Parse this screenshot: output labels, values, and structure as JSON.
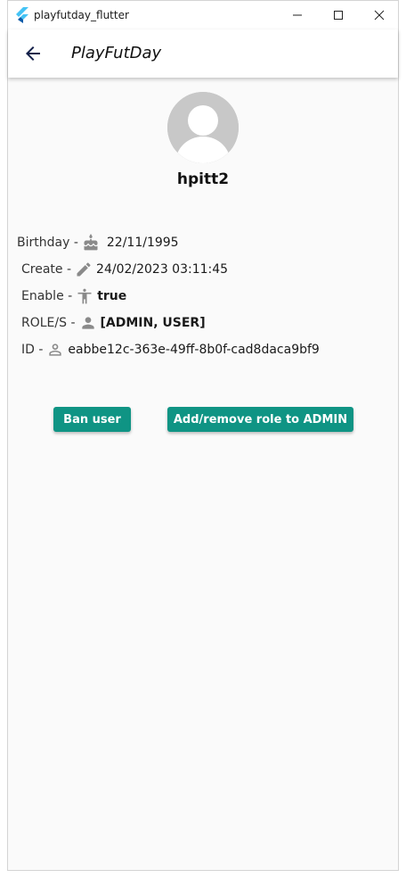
{
  "window": {
    "title": "playfutday_flutter",
    "minimize_icon": "minimize-icon",
    "maximize_icon": "maximize-icon",
    "close_icon": "close-icon"
  },
  "appbar": {
    "title": "PlayFutDay",
    "back_icon": "arrow-back-icon"
  },
  "profile": {
    "username": "hpitt2",
    "avatar_icon": "default-avatar-icon"
  },
  "details": [
    {
      "label": "Birthday -",
      "icon": "cake-icon",
      "value": "22/11/1995"
    },
    {
      "label": "Create -",
      "icon": "pencil-icon",
      "value": "24/02/2023 03:11:45"
    },
    {
      "label": "Enable -",
      "icon": "accessibility-icon",
      "value": "true"
    },
    {
      "label": "ROLE/S -",
      "icon": "person-icon",
      "value": "[ADMIN, USER]"
    },
    {
      "label": "ID -",
      "icon": "person-outline-icon",
      "value": "eabbe12c-363e-49ff-8b0f-cad8daca9bf9"
    }
  ],
  "actions": {
    "ban_label": "Ban user",
    "role_label": "Add/remove role to ADMIN"
  },
  "colors": {
    "accent": "#0f9484",
    "icon_gray": "#8a8a8a",
    "background": "#fafafa"
  }
}
